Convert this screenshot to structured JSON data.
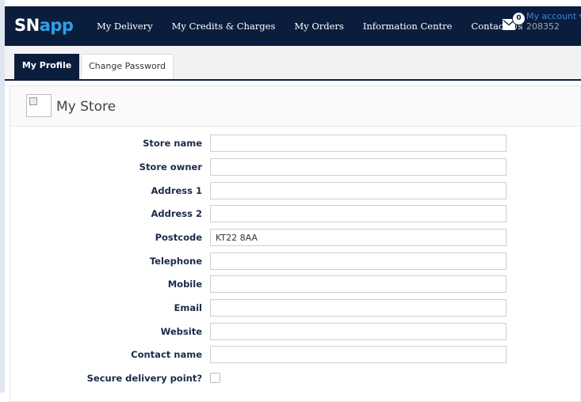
{
  "nav": {
    "brand_a": "SN",
    "brand_b": "app",
    "items": [
      "My Delivery",
      "My Credits & Charges",
      "My Orders",
      "Information Centre",
      "Contact Us"
    ],
    "mail_count": "0",
    "account_label": "My account",
    "account_caret": "▾",
    "account_number": "208352"
  },
  "tabs": {
    "active": "My Profile",
    "second": "Change Password"
  },
  "panel": {
    "title": "My Store",
    "fields": [
      {
        "label": "Store name",
        "value": ""
      },
      {
        "label": "Store owner",
        "value": ""
      },
      {
        "label": "Address 1",
        "value": ""
      },
      {
        "label": "Address 2",
        "value": ""
      },
      {
        "label": "Postcode",
        "value": "KT22 8AA"
      },
      {
        "label": "Telephone",
        "value": ""
      },
      {
        "label": "Mobile",
        "value": ""
      },
      {
        "label": "Email",
        "value": ""
      },
      {
        "label": "Website",
        "value": ""
      },
      {
        "label": "Contact name",
        "value": ""
      }
    ],
    "secure_label": "Secure delivery point?",
    "secure_checked": false
  },
  "colors": {
    "navy": "#0b1d3d",
    "accent": "#2fa0e6"
  }
}
